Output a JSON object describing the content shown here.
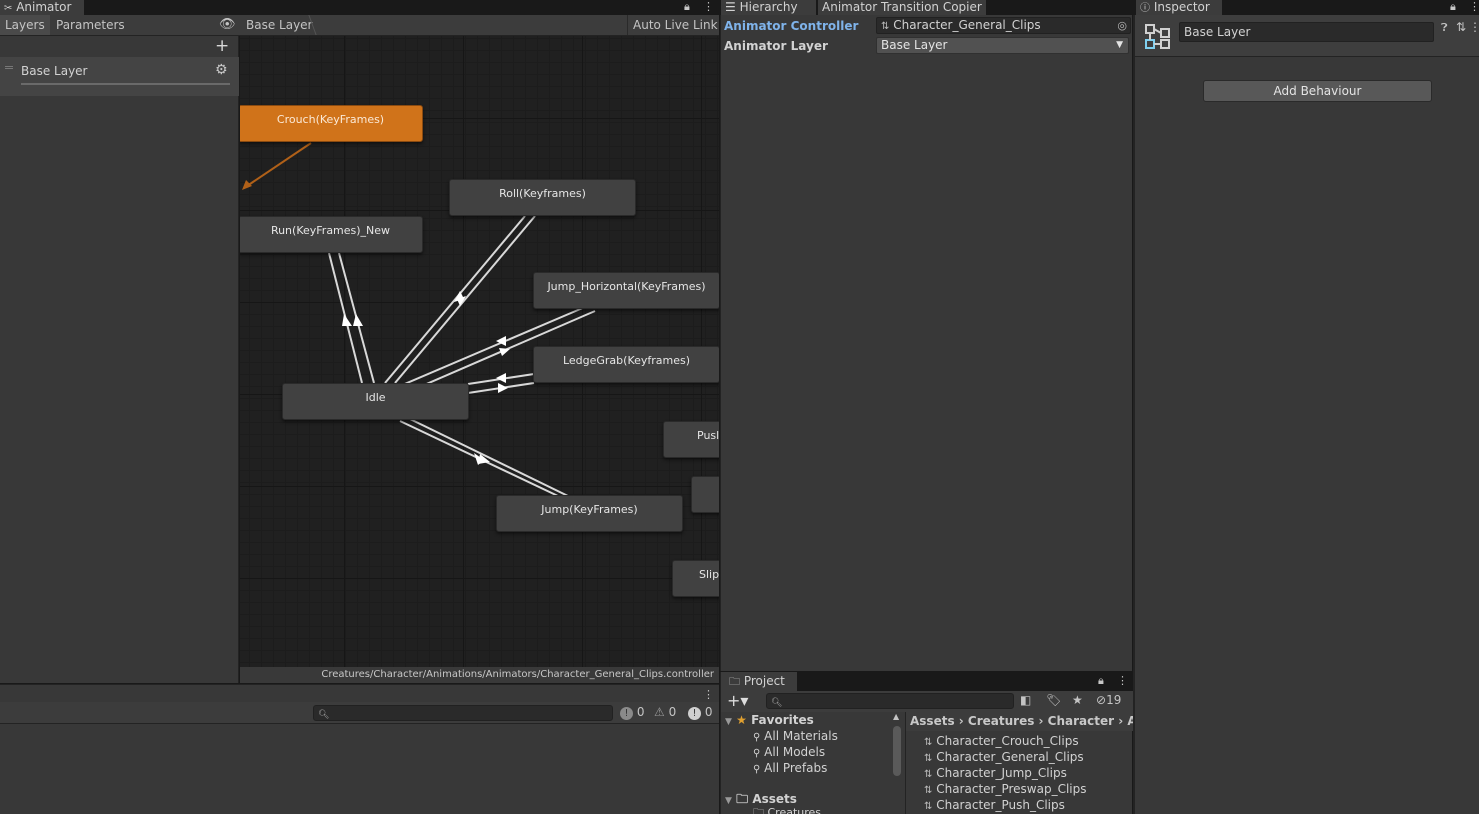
{
  "animator": {
    "tab_title": "Animator",
    "tabs": {
      "layers": "Layers",
      "parameters": "Parameters"
    },
    "breadcrumb": "Base Layer",
    "auto_live_link": "Auto Live Link",
    "layer_name": "Base Layer",
    "states": {
      "crouch": "Crouch(KeyFrames)",
      "roll": "Roll(Keyframes)",
      "run": "Run(KeyFrames)_New",
      "jump_horizontal": "Jump_Horizontal(KeyFrames)",
      "ledge_grab": "LedgeGrab(Keyframes)",
      "idle": "Idle",
      "push": "Pusl",
      "jump": "Jump(KeyFrames)",
      "slip": "Slip",
      "unnamed": ""
    },
    "footer_path": "Creatures/Character/Animations/Animators/Character_General_Clips.controller"
  },
  "console": {
    "counts": {
      "info": "0",
      "warnings": "0",
      "errors": "0"
    }
  },
  "transition_copier": {
    "tabs": {
      "hierarchy": "Hierarchy",
      "copier": "Animator Transition Copier"
    },
    "controller_label": "Animator Controller",
    "controller_value": "Character_General_Clips",
    "layer_label": "Animator Layer",
    "layer_value": "Base Layer"
  },
  "project": {
    "tab_title": "Project",
    "hidden_count": "19",
    "favorites": {
      "label": "Favorites",
      "items": [
        "All Materials",
        "All Models",
        "All Prefabs"
      ]
    },
    "assets_label": "Assets",
    "assets_child": "Creatures",
    "breadcrumb": [
      "Assets",
      "Creatures",
      "Character",
      "A"
    ],
    "files": [
      "Character_Crouch_Clips",
      "Character_General_Clips",
      "Character_Jump_Clips",
      "Character_Preswap_Clips",
      "Character_Push_Clips"
    ]
  },
  "inspector": {
    "tab_title": "Inspector",
    "object_name": "Base Layer",
    "add_behaviour": "Add Behaviour"
  },
  "colors": {
    "accent_blue": "#7fb3ea",
    "state_orange": "#d0731a",
    "transition_line": "#d8d8d8"
  }
}
